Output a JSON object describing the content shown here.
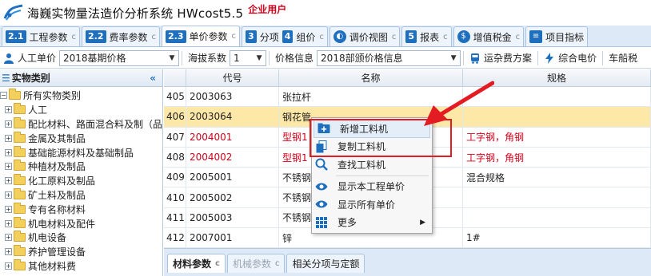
{
  "window": {
    "title": "海巍实物量法造价分析系统 HWcost5.5",
    "edition": "企业用户"
  },
  "tabs": [
    {
      "num": "2.1",
      "label": "工程参数"
    },
    {
      "num": "2.2",
      "label": "费率参数"
    },
    {
      "num": "2.3",
      "label": "单价参数",
      "active": true
    },
    {
      "num": "3",
      "label": "分项"
    },
    {
      "num": "4",
      "label": "组价"
    },
    {
      "icon": "adjust-icon",
      "label": "调价视图"
    },
    {
      "num": "5",
      "label": "报表"
    },
    {
      "icon": "tax-icon",
      "label": "增值税金"
    },
    {
      "icon": "list-icon",
      "label": "项目指标"
    }
  ],
  "toolbar": {
    "labor_label": "人工单价",
    "labor_value": "2018基期价格",
    "altitude_label": "海拔系数",
    "altitude_value": "1",
    "price_info_label": "价格信息",
    "price_info_value": "2018部颁价格信息",
    "transport_label": "运杂费方案",
    "electric_label": "综合电价",
    "vessel_tax_label": "车船税"
  },
  "left_panel": {
    "title": "实物类别",
    "collapse_glyph": "«",
    "root": "所有实物类别",
    "items": [
      "人工",
      "配比材料、路面混合料及制（品",
      "金属及其制品",
      "基础能源材料及基础制品",
      "种植材及制品",
      "化工原料及制品",
      "矿土料及制品",
      "专有名称材料",
      "机电材料及配件",
      "机电设备",
      "养护管理设备",
      "其他材料费"
    ]
  },
  "grid": {
    "headers": [
      "",
      "代号",
      "名称",
      "规格"
    ],
    "rows": [
      {
        "idx": "405",
        "code": "2003063",
        "name": "张拉杆",
        "spec": "",
        "red": false
      },
      {
        "idx": "406",
        "code": "2003064",
        "name": "钢花管",
        "spec": "",
        "red": false,
        "selected": true
      },
      {
        "idx": "407",
        "code": "2004001",
        "name": "型钢1",
        "spec": "工字钢，角钢",
        "red": true
      },
      {
        "idx": "408",
        "code": "2004002",
        "name": "型钢1",
        "spec": "工字钢，角钢",
        "red": true
      },
      {
        "idx": "409",
        "code": "2005001",
        "name": "不锈钢",
        "spec": "混合规格",
        "red": false
      },
      {
        "idx": "410",
        "code": "2005002",
        "name": "不锈钢",
        "spec": "",
        "red": false
      },
      {
        "idx": "411",
        "code": "2005003",
        "name": "不锈钢",
        "spec": "",
        "red": false
      },
      {
        "idx": "412",
        "code": "2007001",
        "name": "锌",
        "spec": "1#",
        "red": false
      }
    ]
  },
  "context_menu": {
    "items": [
      {
        "label": "新增工料机",
        "icon": "add-icon"
      },
      {
        "label": "复制工料机",
        "icon": "copy-icon"
      },
      {
        "label": "查找工料机",
        "icon": "search-icon"
      },
      {
        "label": "显示本工程单价",
        "icon": "eye-icon"
      },
      {
        "label": "显示所有单价",
        "icon": "eye-icon"
      },
      {
        "label": "更多",
        "icon": "grid-icon"
      }
    ]
  },
  "bottom_tabs": [
    {
      "label": "材料参数",
      "active": true
    },
    {
      "label": "机械参数",
      "disabled": true
    },
    {
      "label": "相关分项与定额"
    }
  ],
  "colors": {
    "accent": "#1f6fbf",
    "highlight_red": "#e31b23",
    "selected_row": "#fde8a8",
    "red_text": "#d0021b"
  }
}
